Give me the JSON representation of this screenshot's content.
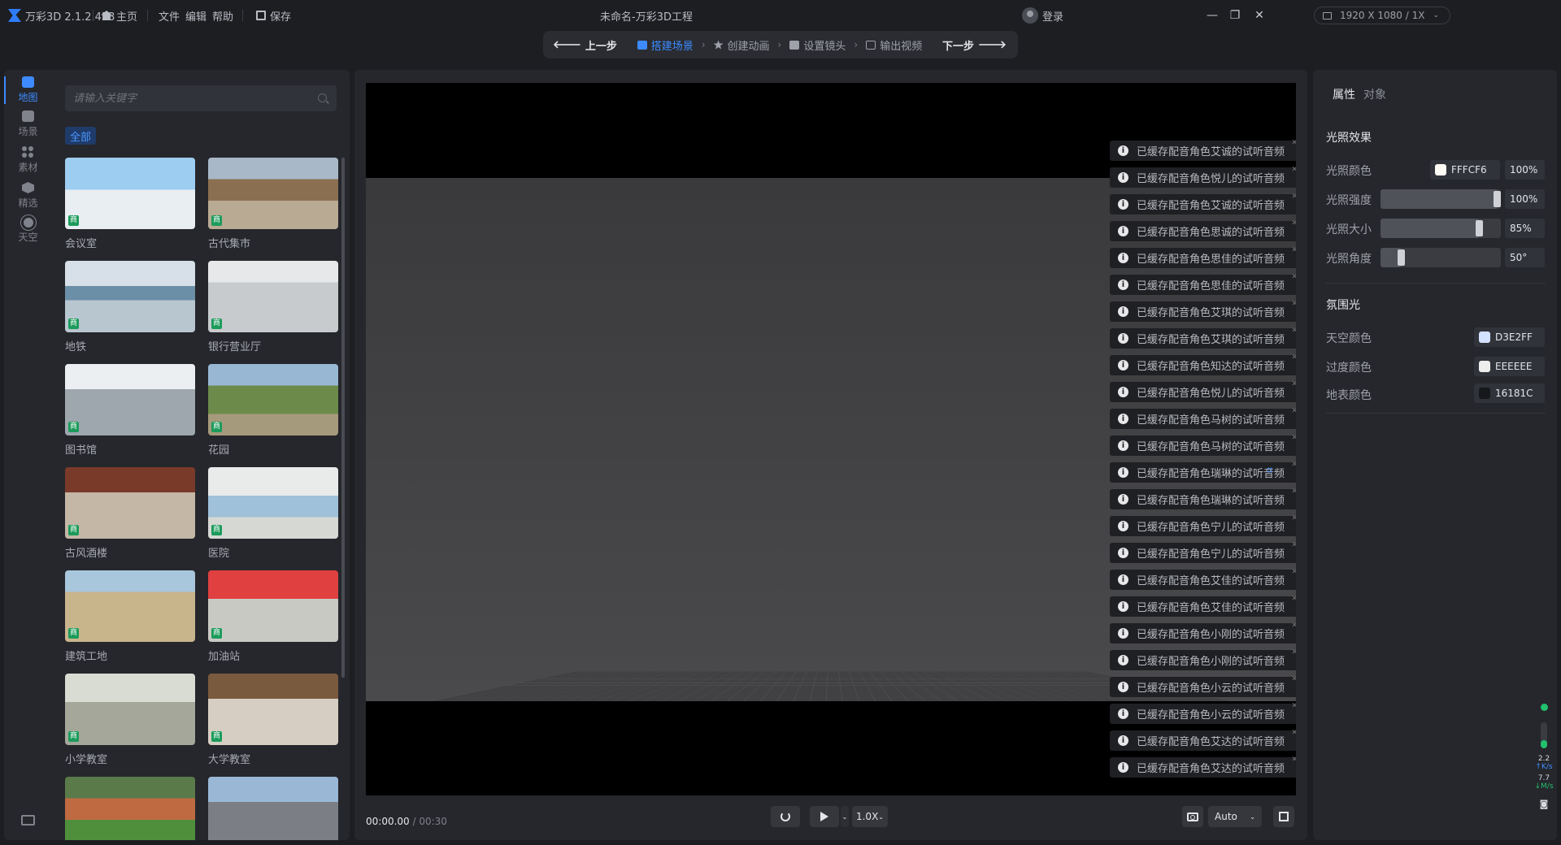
{
  "app": {
    "name": "万彩3D 2.1.2.453",
    "home": "主页",
    "menu": [
      "文件",
      "编辑",
      "帮助"
    ],
    "save": "保存",
    "window_title": "未命名-万彩3D工程",
    "login": "登录",
    "resolution": "1920 X 1080 / 1X",
    "win_min": "—",
    "win_max": "❐",
    "win_close": "✕"
  },
  "steps": {
    "prev": "上一步",
    "items": [
      "搭建场景",
      "创建动画",
      "设置镜头",
      "输出视频"
    ],
    "active_index": 0,
    "next": "下一步"
  },
  "rail": {
    "items": [
      {
        "label": "地图",
        "icon": "map-icon",
        "active": true
      },
      {
        "label": "场景",
        "icon": "scene-icon",
        "active": false
      },
      {
        "label": "素材",
        "icon": "assets-icon",
        "active": false
      },
      {
        "label": "精选",
        "icon": "featured-icon",
        "active": false
      },
      {
        "label": "天空",
        "icon": "sky-icon",
        "active": false
      }
    ]
  },
  "assets": {
    "search_placeholder": "请输入关键字",
    "filter_all": "全部",
    "badge": "商",
    "items": [
      {
        "label": "会议室",
        "thumb": "meeting"
      },
      {
        "label": "古代集市",
        "thumb": "market"
      },
      {
        "label": "地铁",
        "thumb": "subway"
      },
      {
        "label": "银行营业厅",
        "thumb": "bank"
      },
      {
        "label": "图书馆",
        "thumb": "library"
      },
      {
        "label": "花园",
        "thumb": "garden"
      },
      {
        "label": "古风酒楼",
        "thumb": "restaurant"
      },
      {
        "label": "医院",
        "thumb": "hospital"
      },
      {
        "label": "建筑工地",
        "thumb": "construction"
      },
      {
        "label": "加油站",
        "thumb": "gas"
      },
      {
        "label": "小学教室",
        "thumb": "classroom"
      },
      {
        "label": "大学教室",
        "thumb": "university"
      },
      {
        "label": "",
        "thumb": "field"
      },
      {
        "label": "",
        "thumb": "city"
      }
    ]
  },
  "notices": [
    "已缓存配音角色艾诚的试听音频",
    "已缓存配音角色悦儿的试听音频",
    "已缓存配音角色艾诚的试听音频",
    "已缓存配音角色思诚的试听音频",
    "已缓存配音角色思佳的试听音频",
    "已缓存配音角色思佳的试听音频",
    "已缓存配音角色艾琪的试听音频",
    "已缓存配音角色艾琪的试听音频",
    "已缓存配音角色知达的试听音频",
    "已缓存配音角色悦儿的试听音频",
    "已缓存配音角色马树的试听音频",
    "已缓存配音角色马树的试听音频",
    "已缓存配音角色瑞琳的试听音频",
    "已缓存配音角色瑞琳的试听音频",
    "已缓存配音角色宁儿的试听音频",
    "已缓存配音角色宁儿的试听音频",
    "已缓存配音角色艾佳的试听音频",
    "已缓存配音角色艾佳的试听音频",
    "已缓存配音角色小刚的试听音频",
    "已缓存配音角色小刚的试听音频",
    "已缓存配音角色小云的试听音频",
    "已缓存配音角色小云的试听音频",
    "已缓存配音角色艾达的试听音频",
    "已缓存配音角色艾达的试听音频"
  ],
  "playback": {
    "current": "00:00.00",
    "separator": " / ",
    "total": "00:30",
    "speed": "1.0X",
    "quality": "Auto"
  },
  "properties": {
    "tabs": [
      "属性",
      "对象"
    ],
    "lighting": {
      "title": "光照效果",
      "color_label": "光照颜色",
      "color_value": "FFFCF6",
      "color_hex": "#FFFCF6",
      "color_pct": "100%",
      "intensity_label": "光照强度",
      "intensity_pct": "100%",
      "intensity_level": 1.0,
      "size_label": "光照大小",
      "size_pct": "85%",
      "size_level": 0.85,
      "angle_label": "光照角度",
      "angle_value": "50°",
      "angle_level": 0.2
    },
    "ambient": {
      "title": "氛围光",
      "sky_label": "天空颜色",
      "sky_value": "D3E2FF",
      "sky_hex": "#D3E2FF",
      "transition_label": "过度颜色",
      "transition_value": "EEEEEE",
      "transition_hex": "#EEEEEE",
      "ground_label": "地表颜色",
      "ground_value": "16181C",
      "ground_hex": "#16181C"
    }
  },
  "perf": {
    "up_value": "2.2",
    "up_unit": "K/s",
    "down_value": "7.7",
    "down_unit": "M/s"
  }
}
